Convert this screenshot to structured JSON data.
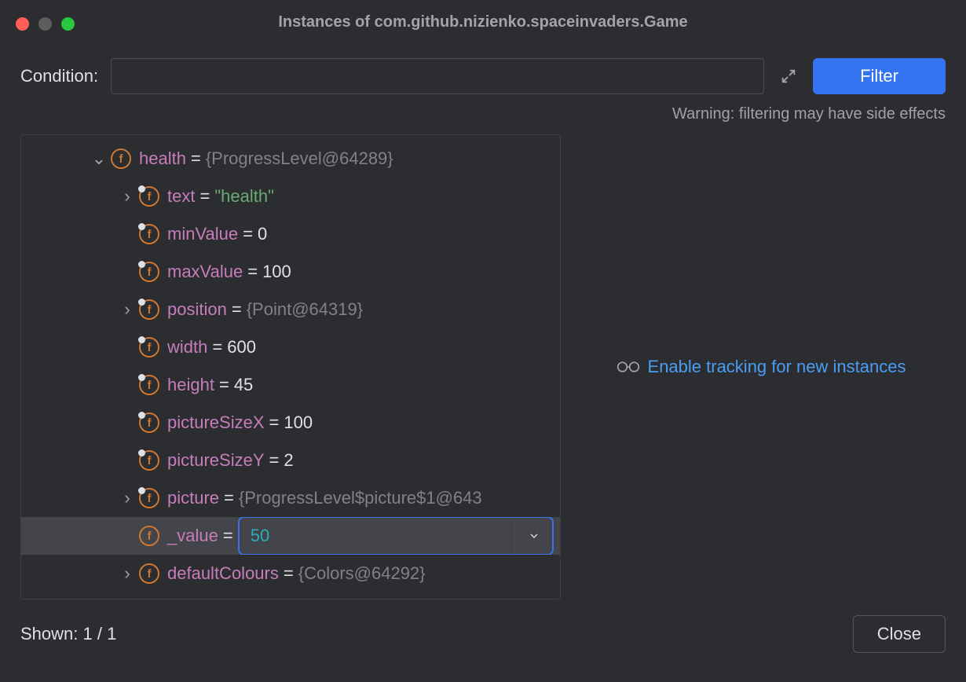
{
  "window": {
    "title": "Instances of com.github.nizienko.spaceinvaders.Game"
  },
  "conditionRow": {
    "label": "Condition:",
    "value": ""
  },
  "filterButton": "Filter",
  "warning": "Warning: filtering may have side effects",
  "tracking": {
    "linkText": "Enable tracking for new instances"
  },
  "tree": {
    "rows": [
      {
        "indent": 0,
        "chevron": "down",
        "tagged": false,
        "name": "health",
        "valueType": "obj",
        "value": "{ProgressLevel@64289}",
        "selected": false
      },
      {
        "indent": 1,
        "chevron": "right",
        "tagged": true,
        "name": "text",
        "valueType": "str",
        "value": "\"health\"",
        "selected": false
      },
      {
        "indent": 1,
        "chevron": "none",
        "tagged": true,
        "name": "minValue",
        "valueType": "num",
        "value": "0",
        "selected": false
      },
      {
        "indent": 1,
        "chevron": "none",
        "tagged": true,
        "name": "maxValue",
        "valueType": "num",
        "value": "100",
        "selected": false
      },
      {
        "indent": 1,
        "chevron": "right",
        "tagged": true,
        "name": "position",
        "valueType": "obj",
        "value": "{Point@64319}",
        "selected": false
      },
      {
        "indent": 1,
        "chevron": "none",
        "tagged": true,
        "name": "width",
        "valueType": "num",
        "value": "600",
        "selected": false
      },
      {
        "indent": 1,
        "chevron": "none",
        "tagged": true,
        "name": "height",
        "valueType": "num",
        "value": "45",
        "selected": false
      },
      {
        "indent": 1,
        "chevron": "none",
        "tagged": true,
        "name": "pictureSizeX",
        "valueType": "num",
        "value": "100",
        "selected": false
      },
      {
        "indent": 1,
        "chevron": "none",
        "tagged": true,
        "name": "pictureSizeY",
        "valueType": "num",
        "value": "2",
        "selected": false
      },
      {
        "indent": 1,
        "chevron": "right",
        "tagged": true,
        "name": "picture",
        "valueType": "obj",
        "value": "{ProgressLevel$picture$1@643",
        "selected": false
      },
      {
        "indent": 1,
        "chevron": "none",
        "tagged": false,
        "name": "_value",
        "valueType": "edit",
        "value": "50",
        "selected": true
      },
      {
        "indent": 1,
        "chevron": "right",
        "tagged": false,
        "name": "defaultColours",
        "valueType": "obj",
        "value": "{Colors@64292}",
        "selected": false
      }
    ]
  },
  "footer": {
    "shown": "Shown: 1 / 1",
    "closeButton": "Close"
  }
}
